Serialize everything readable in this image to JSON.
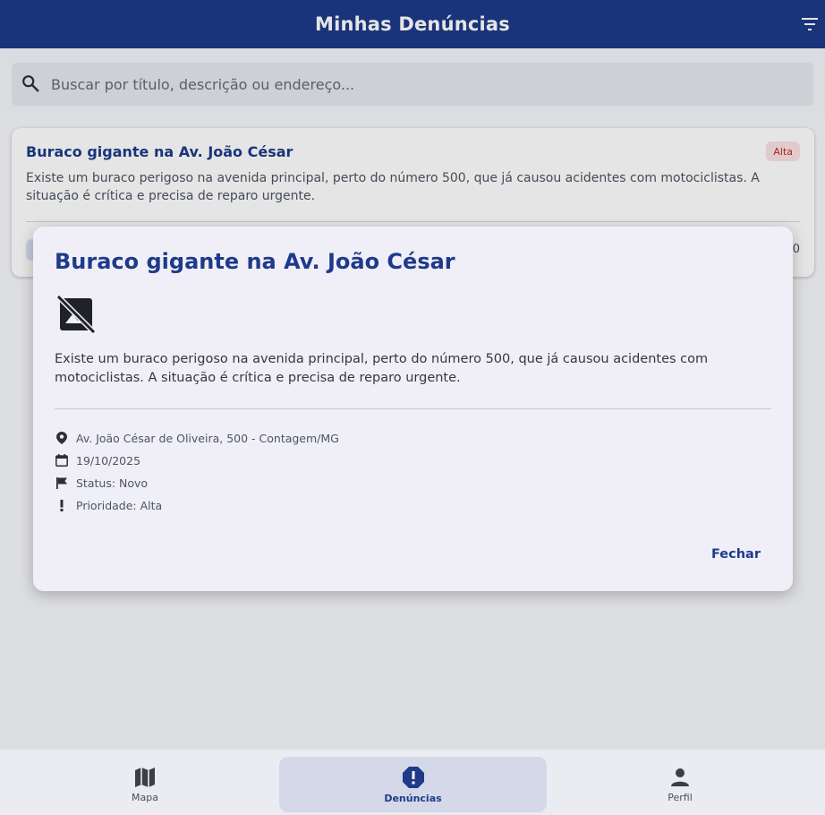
{
  "app": {
    "title": "Minhas Denúncias",
    "colors": {
      "primary": "#1e3a8a",
      "priority_high_bg": "#fbe1e1",
      "priority_high_text": "#c62828"
    }
  },
  "search": {
    "placeholder": "Buscar por título, descrição ou endereço..."
  },
  "report_card": {
    "title": "Buraco gigante na Av. João César",
    "priority_badge": "Alta",
    "description": "Existe um buraco perigoso na avenida principal, perto do número 500, que já causou acidentes com motociclistas. A situação é crítica e precisa de reparo urgente."
  },
  "dialog": {
    "title": "Buraco gigante na Av. João César",
    "image_icon": "hide-image-icon",
    "description": "Existe um buraco perigoso na avenida principal, perto do número 500, que já causou acidentes com motociclistas. A situação é crítica e precisa de reparo urgente.",
    "address": "Av. João César de Oliveira, 500 - Contagem/MG",
    "date": "19/10/2025",
    "status": "Status: Novo",
    "priority": "Prioridade: Alta",
    "close_label": "Fechar"
  },
  "bottom_nav": {
    "items": [
      {
        "label": "Mapa",
        "icon": "map-icon",
        "active": false
      },
      {
        "label": "Denúncias",
        "icon": "report-icon",
        "active": true
      },
      {
        "label": "Perfil",
        "icon": "person-icon",
        "active": false
      }
    ]
  }
}
